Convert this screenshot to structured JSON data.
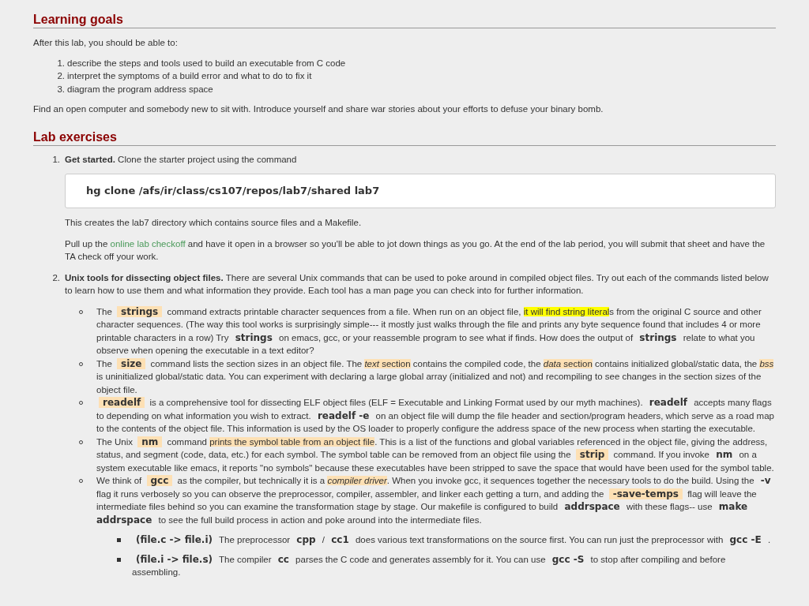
{
  "learning_goals": {
    "heading": "Learning goals",
    "intro": "After this lab, you should be able to:",
    "goals": [
      {
        "number": "1.",
        "text": "describe the steps and tools used to build an executable from C code"
      },
      {
        "number": "2.",
        "text": "interpret the symptoms of a build error and what to do to fix it"
      },
      {
        "number": "3.",
        "text": "diagram the program address space"
      }
    ],
    "closing": "Find an open computer and somebody new to sit with. Introduce yourself and share war stories about your efforts to defuse your binary bomb."
  },
  "lab_exercises": {
    "heading": "Lab exercises",
    "items": [
      {
        "number": "1.",
        "blocks": [
          {
            "kind": "para",
            "segments": [
              {
                "kind": "bold",
                "text": "Get started."
              },
              {
                "kind": "text",
                "text": " Clone the starter project using the command"
              }
            ]
          },
          {
            "kind": "code_block",
            "text": "hg clone /afs/ir/class/cs107/repos/lab7/shared lab7"
          },
          {
            "kind": "para",
            "segments": [
              {
                "kind": "text",
                "text": "This creates the lab7 directory which contains source files and a Makefile."
              }
            ]
          },
          {
            "kind": "para",
            "segments": [
              {
                "kind": "text",
                "text": "Pull up the "
              },
              {
                "kind": "link",
                "text": "online lab checkoff"
              },
              {
                "kind": "text",
                "text": " and have it open in a browser so you'll be able to jot down things as you go. At the end of the lab period, you will submit that sheet and have the TA check off your work."
              }
            ]
          }
        ]
      },
      {
        "number": "2.",
        "blocks": [
          {
            "kind": "para",
            "segments": [
              {
                "kind": "bold",
                "text": "Unix tools for dissecting object files."
              },
              {
                "kind": "text",
                "text": " There are several Unix commands that can be used to poke around in compiled object files. Try out each of the commands listed below to learn how to use them and what information they provide. Each tool has a man page you can check into for further information."
              }
            ]
          },
          {
            "kind": "bullets",
            "items": [
              {
                "segments": [
                  {
                    "kind": "text",
                    "text": "The "
                  },
                  {
                    "kind": "code_hl",
                    "text": "strings"
                  },
                  {
                    "kind": "text",
                    "text": " command extracts printable character sequences from a file. When run on an object file, "
                  },
                  {
                    "kind": "yellow",
                    "text": "it will find string literal"
                  },
                  {
                    "kind": "text",
                    "text": "s from the original C source and other character sequences. (The way this tool works is surprisingly simple--- it mostly just walks through the file and prints any byte sequence found that includes 4 or more printable characters in a row) Try "
                  },
                  {
                    "kind": "code",
                    "text": "strings"
                  },
                  {
                    "kind": "text",
                    "text": " on emacs, gcc, or your reassemble program to see what if finds. How does the output of "
                  },
                  {
                    "kind": "code",
                    "text": "strings"
                  },
                  {
                    "kind": "text",
                    "text": " relate to what you observe when opening the executable in a text editor?"
                  }
                ]
              },
              {
                "segments": [
                  {
                    "kind": "text",
                    "text": "The "
                  },
                  {
                    "kind": "code_hl",
                    "text": "size"
                  },
                  {
                    "kind": "text",
                    "text": " command lists the section sizes in an object file. The "
                  },
                  {
                    "kind": "hl",
                    "text": "*text* section"
                  },
                  {
                    "kind": "text",
                    "text": " contains the compiled code, the "
                  },
                  {
                    "kind": "hl",
                    "text": "*data* section"
                  },
                  {
                    "kind": "text",
                    "text": " contains initialized global/static data, the "
                  },
                  {
                    "kind": "hl",
                    "text": "*bss*"
                  },
                  {
                    "kind": "text",
                    "text": " is uninitialized global/static data. You can experiment with declaring a large global array (initialized and not) and recompiling to see changes in the section sizes of the object file."
                  }
                ]
              },
              {
                "segments": [
                  {
                    "kind": "code_hl",
                    "text": "readelf"
                  },
                  {
                    "kind": "text",
                    "text": " is a comprehensive tool for dissecting ELF object files (ELF = Executable and Linking Format used by our myth machines). "
                  },
                  {
                    "kind": "code",
                    "text": "readelf"
                  },
                  {
                    "kind": "text",
                    "text": " accepts many flags to depending on what information you wish to extract. "
                  },
                  {
                    "kind": "code",
                    "text": "readelf -e"
                  },
                  {
                    "kind": "text",
                    "text": " on an object file will dump the file header and section/program headers, which serve as a road map to the contents of the object file. This information is used by the OS loader to properly configure the address space of the new process when starting the executable."
                  }
                ]
              },
              {
                "segments": [
                  {
                    "kind": "text",
                    "text": "The Unix "
                  },
                  {
                    "kind": "code_hl",
                    "text": "nm"
                  },
                  {
                    "kind": "text",
                    "text": " command "
                  },
                  {
                    "kind": "hl",
                    "text": "prints the symbol table from an object file"
                  },
                  {
                    "kind": "text",
                    "text": ". This is a list of the functions and global variables referenced in the object file, giving the address, status, and segment (code, data, etc.) for each symbol. The symbol table can be removed from an object file using the "
                  },
                  {
                    "kind": "code_hl",
                    "text": "strip"
                  },
                  {
                    "kind": "text",
                    "text": " command. If you invoke "
                  },
                  {
                    "kind": "code",
                    "text": "nm"
                  },
                  {
                    "kind": "text",
                    "text": " on a system executable like emacs, it reports \"no symbols\" because these executables have been stripped to save the space that would have been used for the symbol table."
                  }
                ]
              },
              {
                "segments": [
                  {
                    "kind": "text",
                    "text": "We think of "
                  },
                  {
                    "kind": "code_hl",
                    "text": "gcc"
                  },
                  {
                    "kind": "text",
                    "text": " as the compiler, but technically it is a "
                  },
                  {
                    "kind": "hl",
                    "text": "*compiler driver*"
                  },
                  {
                    "kind": "text",
                    "text": ". When you invoke gcc, it sequences together the necessary tools to do the build. Using the "
                  },
                  {
                    "kind": "code",
                    "text": "-v"
                  },
                  {
                    "kind": "text",
                    "text": " flag it runs verbosely so you can observe the preprocessor, compiler, assembler, and linker each getting a turn, and adding the "
                  },
                  {
                    "kind": "code_hl",
                    "text": "-save-temps"
                  },
                  {
                    "kind": "text",
                    "text": " flag will leave the intermediate files behind so you can examine the transformation stage by stage. Our makefile is configured to build "
                  },
                  {
                    "kind": "code",
                    "text": "addrspace"
                  },
                  {
                    "kind": "text",
                    "text": " with these flags-- use "
                  },
                  {
                    "kind": "code",
                    "text": "make addrspace"
                  },
                  {
                    "kind": "text",
                    "text": " to see the full build process in action and poke around into the intermediate files."
                  }
                ],
                "children": [
                  {
                    "segments": [
                      {
                        "kind": "code",
                        "text": "(file.c -> file.i)"
                      },
                      {
                        "kind": "text",
                        "text": " The preprocessor "
                      },
                      {
                        "kind": "code",
                        "text": "cpp"
                      },
                      {
                        "kind": "text",
                        "text": " / "
                      },
                      {
                        "kind": "code",
                        "text": "cc1"
                      },
                      {
                        "kind": "text",
                        "text": " does various text transformations on the source first. You can run just the preprocessor with "
                      },
                      {
                        "kind": "code",
                        "text": "gcc -E"
                      },
                      {
                        "kind": "text",
                        "text": " ."
                      }
                    ]
                  },
                  {
                    "segments": [
                      {
                        "kind": "code",
                        "text": "(file.i -> file.s)"
                      },
                      {
                        "kind": "text",
                        "text": " The compiler "
                      },
                      {
                        "kind": "code",
                        "text": "cc"
                      },
                      {
                        "kind": "text",
                        "text": " parses the C code and generates assembly for it. You can use "
                      },
                      {
                        "kind": "code",
                        "text": "gcc -S"
                      },
                      {
                        "kind": "text",
                        "text": " to stop after compiling and before assembling."
                      }
                    ]
                  }
                ]
              }
            ]
          }
        ]
      }
    ]
  }
}
